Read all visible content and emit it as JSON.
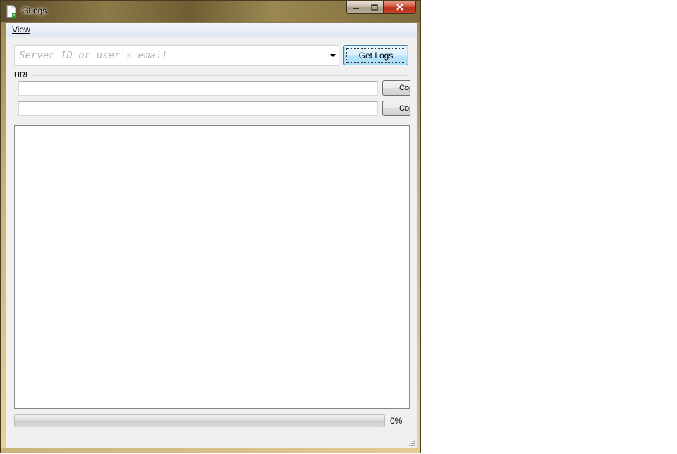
{
  "window": {
    "title": "GLogs",
    "icon": "document-with-green-badge-icon"
  },
  "caption_buttons": {
    "minimize": "minimize-icon",
    "maximize": "maximize-icon",
    "close": "close-icon"
  },
  "menu": {
    "items": [
      {
        "label": "View"
      }
    ]
  },
  "search": {
    "placeholder": "Server ID or user's email",
    "value": "",
    "get_logs_label": "Get Logs"
  },
  "url_group": {
    "label": "URL",
    "fields": [
      {
        "value": "",
        "copy_label": "Copy"
      },
      {
        "value": "",
        "copy_label": "Copy"
      }
    ]
  },
  "log": {
    "text": ""
  },
  "progress": {
    "value": 0,
    "text": "0%"
  },
  "colors": {
    "frame": "#c7b37a",
    "client": "#f0f0f0",
    "focus_border": "#3c7fb1",
    "progress_fill": "#37b12a"
  }
}
